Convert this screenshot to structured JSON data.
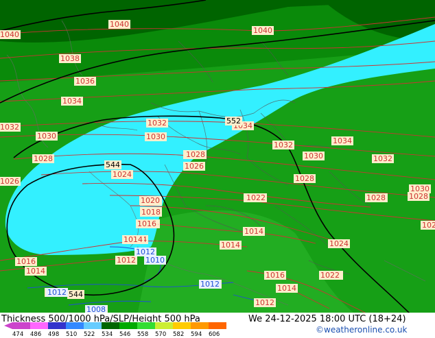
{
  "map": {
    "colors": {
      "band_dark": "#006400",
      "band_mid": "#0a8a0a",
      "band_light": "#169f16",
      "band_bright": "#2db82d",
      "cyan": "#33f0ff",
      "isobar": "#cc3333",
      "height": "#000000",
      "low_isobar": "#1f4fd6",
      "label_bg": "#ffeecc"
    },
    "isobar_labels": [
      "1040",
      "1040",
      "1040",
      "1038",
      "1036",
      "1034",
      "1032",
      "1030",
      "1028",
      "1026",
      "1024",
      "1022",
      "1020",
      "1018",
      "1016",
      "1014",
      "1014",
      "1016",
      "1014",
      "1032",
      "1030",
      "1028",
      "1026",
      "1022",
      "1034",
      "1032",
      "1034",
      "1030",
      "1032",
      "1028",
      "1030",
      "1028",
      "1026",
      "1028",
      "1024",
      "1022",
      "1014",
      "1016",
      "1014",
      "1022",
      "1020",
      "1018",
      "1016",
      "1014",
      "1012",
      "1012",
      "1012",
      "1012",
      "1008",
      "1010",
      "1028",
      "1028"
    ],
    "height_labels": [
      "552",
      "544",
      "544"
    ],
    "low_labels": [
      "1012",
      "1010",
      "1012",
      "1012",
      "1008"
    ]
  },
  "footer": {
    "title": "Thickness 500/1000 hPa/SLP/Height 500 hPa",
    "valid": "We 24-12-2025 18:00 UTC (18+24)",
    "credit": "©weatheronline.co.uk",
    "scale_values": [
      "474",
      "486",
      "498",
      "510",
      "522",
      "534",
      "546",
      "558",
      "570",
      "582",
      "594",
      "606"
    ],
    "scale_colors": [
      "#cc44cc",
      "#ff66ff",
      "#3333cc",
      "#3388ff",
      "#66ccff",
      "#006600",
      "#00aa00",
      "#33dd33",
      "#ccee33",
      "#ffcc00",
      "#ff9900",
      "#ff6600"
    ]
  }
}
